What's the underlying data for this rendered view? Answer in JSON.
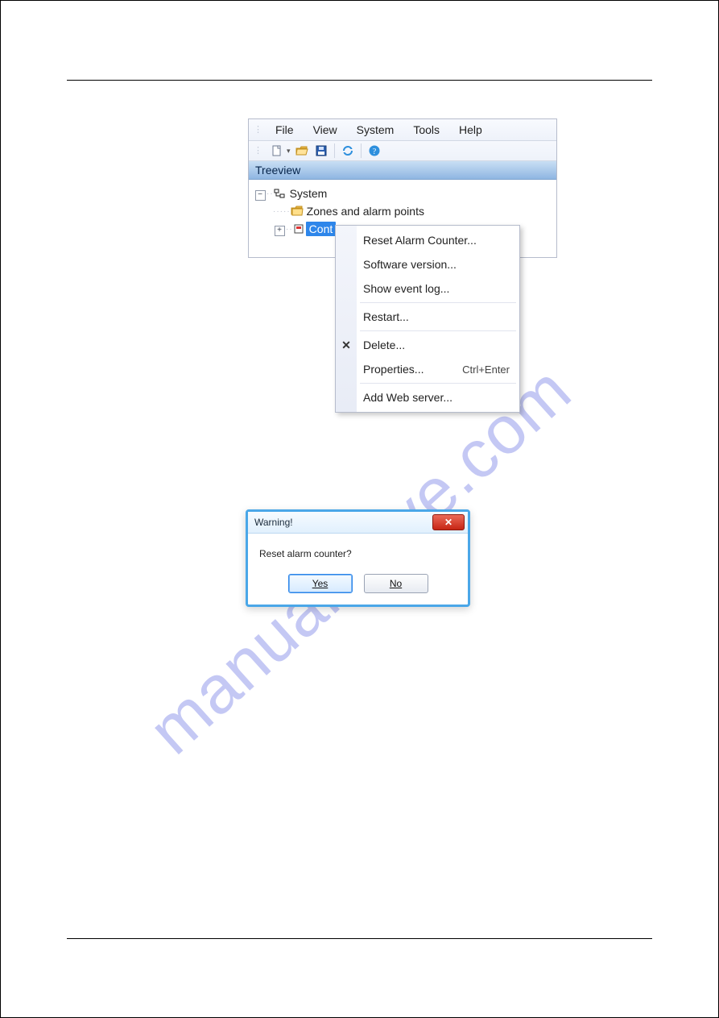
{
  "menubar": [
    "File",
    "View",
    "System",
    "Tools",
    "Help"
  ],
  "panel_title": "Treeview",
  "tree": {
    "root": "System",
    "child_1": "Zones and alarm points",
    "child_2_visible": "Cont"
  },
  "context_menu": {
    "items": [
      {
        "label": "Reset Alarm Counter..."
      },
      {
        "label": "Software version..."
      },
      {
        "label": "Show event log..."
      },
      {
        "sep": true
      },
      {
        "label": "Restart..."
      },
      {
        "sep": true
      },
      {
        "label": "Delete...",
        "icon": "✕"
      },
      {
        "label": "Properties...",
        "hotkey": "Ctrl+Enter"
      },
      {
        "sep": true
      },
      {
        "label": "Add Web server..."
      }
    ]
  },
  "dialog": {
    "title": "Warning!",
    "message": "Reset alarm counter?",
    "yes": "Yes",
    "no": "No"
  },
  "watermark": "manualshive.com"
}
